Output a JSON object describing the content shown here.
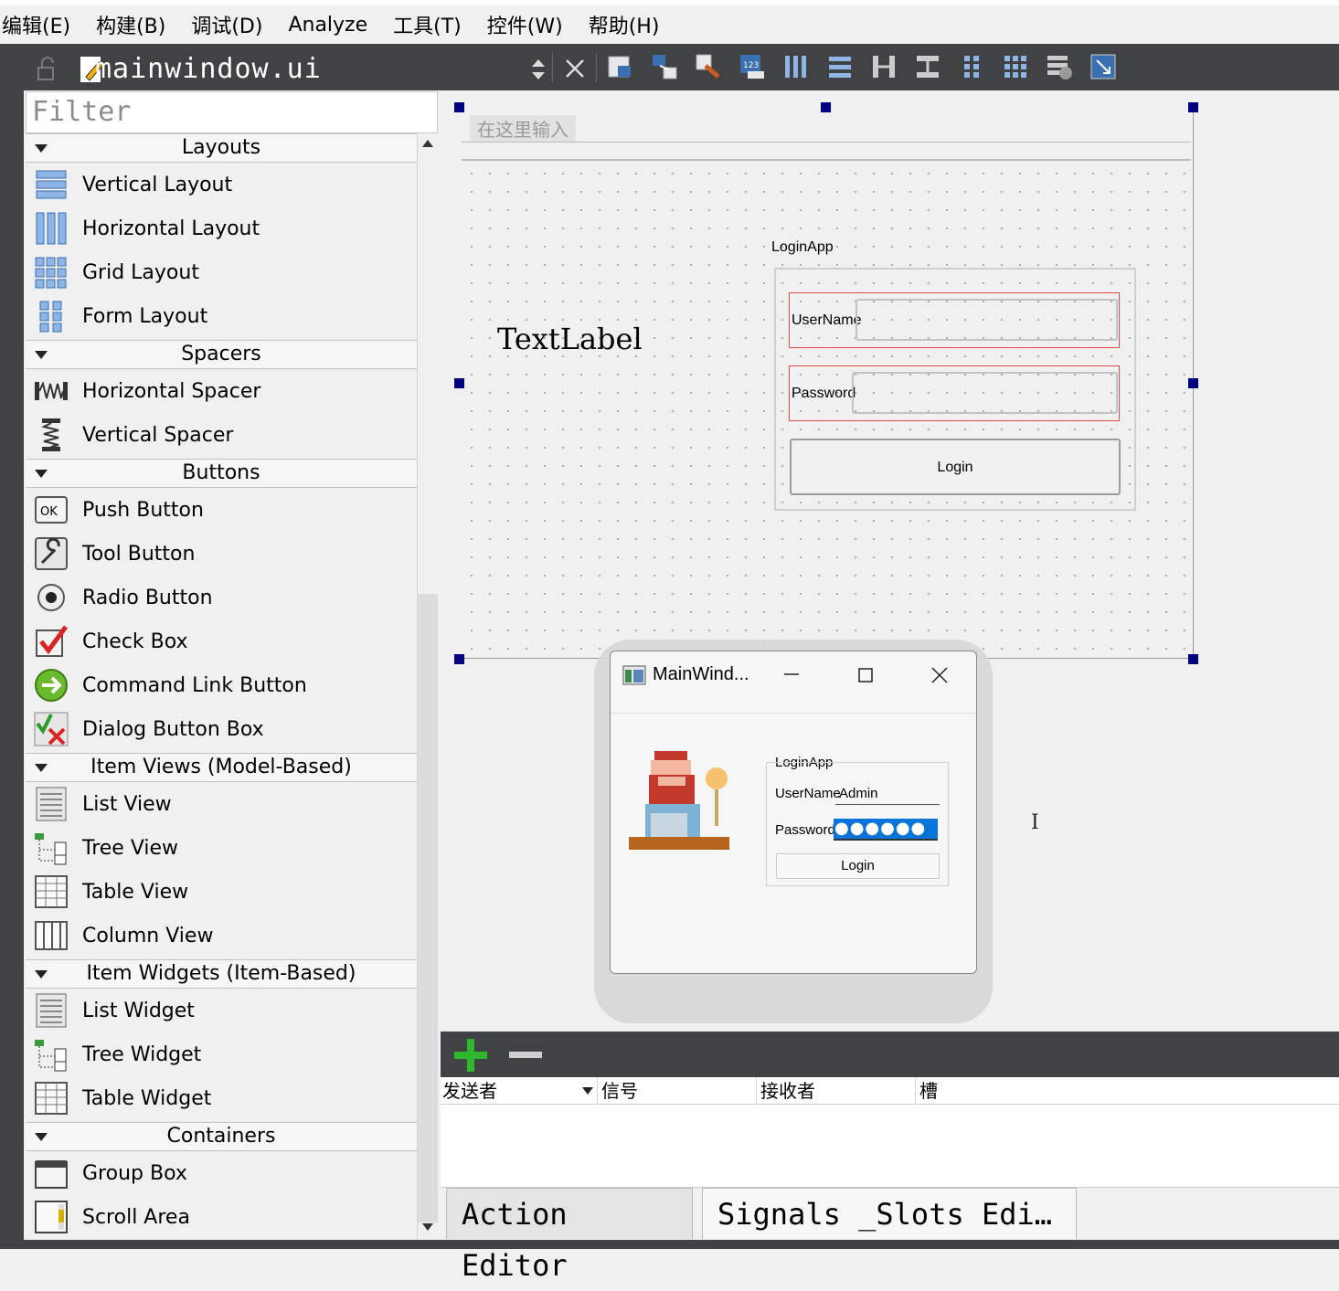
{
  "menu": [
    "编辑(E)",
    "构建(B)",
    "调试(D)",
    "Analyze",
    "工具(T)",
    "控件(W)",
    "帮助(H)"
  ],
  "editor": {
    "file_name": "mainwindow.ui"
  },
  "toolbar": {
    "icons": [
      "edit-widgets-icon",
      "edit-signals-slots-icon",
      "edit-buddies-icon",
      "edit-tab-order-icon",
      "layout-horizontal-icon",
      "layout-vertical-icon",
      "layout-horizontal-splitter-icon",
      "layout-vertical-splitter-icon",
      "layout-form-icon",
      "layout-grid-icon",
      "break-layout-icon",
      "adjust-size-icon"
    ]
  },
  "widget_box": {
    "filter_placeholder": "Filter",
    "categories": [
      {
        "label": "Layouts",
        "items": [
          "Vertical Layout",
          "Horizontal Layout",
          "Grid Layout",
          "Form Layout"
        ]
      },
      {
        "label": "Spacers",
        "items": [
          "Horizontal Spacer",
          "Vertical Spacer"
        ]
      },
      {
        "label": "Buttons",
        "items": [
          "Push Button",
          "Tool Button",
          "Radio Button",
          "Check Box",
          "Command Link Button",
          "Dialog Button Box"
        ]
      },
      {
        "label": "Item Views (Model-Based)",
        "items": [
          "List View",
          "Tree View",
          "Table View",
          "Column View"
        ]
      },
      {
        "label": "Item Widgets (Item-Based)",
        "items": [
          "List Widget",
          "Tree Widget",
          "Table Widget"
        ]
      },
      {
        "label": "Containers",
        "items": [
          "Group Box",
          "Scroll Area"
        ]
      }
    ]
  },
  "form": {
    "menu_placeholder": "在这里输入",
    "text_label": "TextLabel",
    "group_title": "LoginApp",
    "username_label": "UserName",
    "password_label": "Password",
    "login_button": "Login"
  },
  "preview": {
    "title": "MainWind...",
    "group_title": "LoginApp",
    "username_label": "UserName",
    "username_value": "Admin",
    "password_label": "Password",
    "password_mask": "●●●●●●",
    "login_button": "Login"
  },
  "signal_slot_editor": {
    "columns": [
      "发送者",
      "信号",
      "接收者",
      "槽"
    ]
  },
  "bottom_tabs": [
    "Action Editor",
    "Signals _Slots Edi…"
  ],
  "colors": {
    "dark_toolbar": "#404244",
    "handle": "#000080",
    "selection": "#0a74d8",
    "add": "#2eb82e"
  }
}
